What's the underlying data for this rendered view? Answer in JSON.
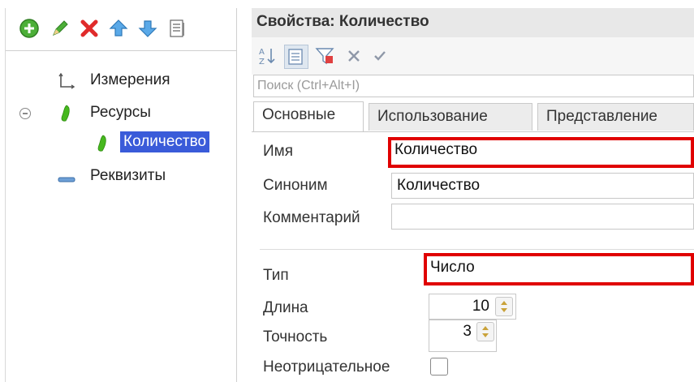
{
  "left_panel": {
    "toolbar": {
      "icons": [
        "add-icon",
        "edit-icon",
        "delete-icon",
        "move-up-icon",
        "move-down-icon",
        "list-icon"
      ]
    },
    "tree": [
      {
        "label": "Измерения",
        "icon": "dimensions-icon"
      },
      {
        "label": "Ресурсы",
        "icon": "resource-icon",
        "expanded": true
      },
      {
        "label": "Количество",
        "icon": "resource-icon",
        "selected": true
      },
      {
        "label": "Реквизиты",
        "icon": "attribute-icon"
      }
    ]
  },
  "properties": {
    "title": "Свойства: Количество",
    "toolbar_icons": [
      "sort-az-icon",
      "categories-icon",
      "filter-icon",
      "cancel-icon",
      "apply-icon"
    ],
    "search_placeholder": "Поиск (Ctrl+Alt+I)",
    "tabs": [
      {
        "label": "Основные",
        "active": true
      },
      {
        "label": "Использование",
        "active": false
      },
      {
        "label": "Представление",
        "active": false
      }
    ],
    "fields": {
      "name": {
        "label": "Имя",
        "value": "Количество"
      },
      "synonym": {
        "label": "Синоним",
        "value": "Количество"
      },
      "comment": {
        "label": "Комментарий",
        "value": ""
      },
      "type": {
        "label": "Тип",
        "value": "Число"
      },
      "length": {
        "label": "Длина",
        "value": "10"
      },
      "precision": {
        "label": "Точность",
        "value": "3"
      },
      "nonnegative": {
        "label": "Неотрицательное",
        "checked": false
      }
    }
  },
  "colors": {
    "highlight": "#e00000",
    "selection": "#3a5bd9",
    "resource_green": "#46b81e"
  }
}
